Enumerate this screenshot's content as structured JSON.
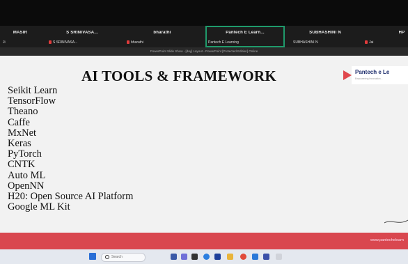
{
  "meeting": {
    "tiles": [
      {
        "name": "MASIR",
        "sub": "Ji"
      },
      {
        "name": "S SRINIVASA...",
        "sub": "S SRINIVASA..."
      },
      {
        "name": "bharathi",
        "sub": "bharathi"
      },
      {
        "name": "Pantech E Learn...",
        "sub": "Pantech E Learning"
      },
      {
        "name": "SUBHASHINI N",
        "sub": "SUBHASHINI N"
      },
      {
        "name": "",
        "sub": "Jai"
      },
      {
        "name": "HP",
        "sub": ""
      }
    ],
    "share_notice": "PowerPoint Slide Show - [day] Layout - PowerPoint [Protected Edition] Online"
  },
  "slide": {
    "title": "AI TOOLS & FRAMEWORK",
    "brand": "Pantech e Le",
    "brand_sub": "Empowering Innovation...",
    "items": [
      "Seikit Learn",
      "TensorFlow",
      "Theano",
      "Caffe",
      "MxNet",
      "Keras",
      "PyTorch",
      "CNTK",
      "Auto ML",
      "OpenNN",
      "H20: Open Source AI Platform",
      "Google ML Kit"
    ],
    "footer_url": "www.pantechelearn"
  },
  "taskbar": {
    "search_placeholder": "Search",
    "icons": [
      "windows-icon",
      "search-icon",
      "widgets-icon",
      "teams-icon",
      "file-explorer-icon",
      "chrome-icon",
      "edge-icon",
      "store-icon",
      "mail-icon",
      "photos-icon",
      "settings-icon"
    ],
    "colors": {
      "windows": "#2a6fd6",
      "accent": "#d9474f"
    }
  }
}
